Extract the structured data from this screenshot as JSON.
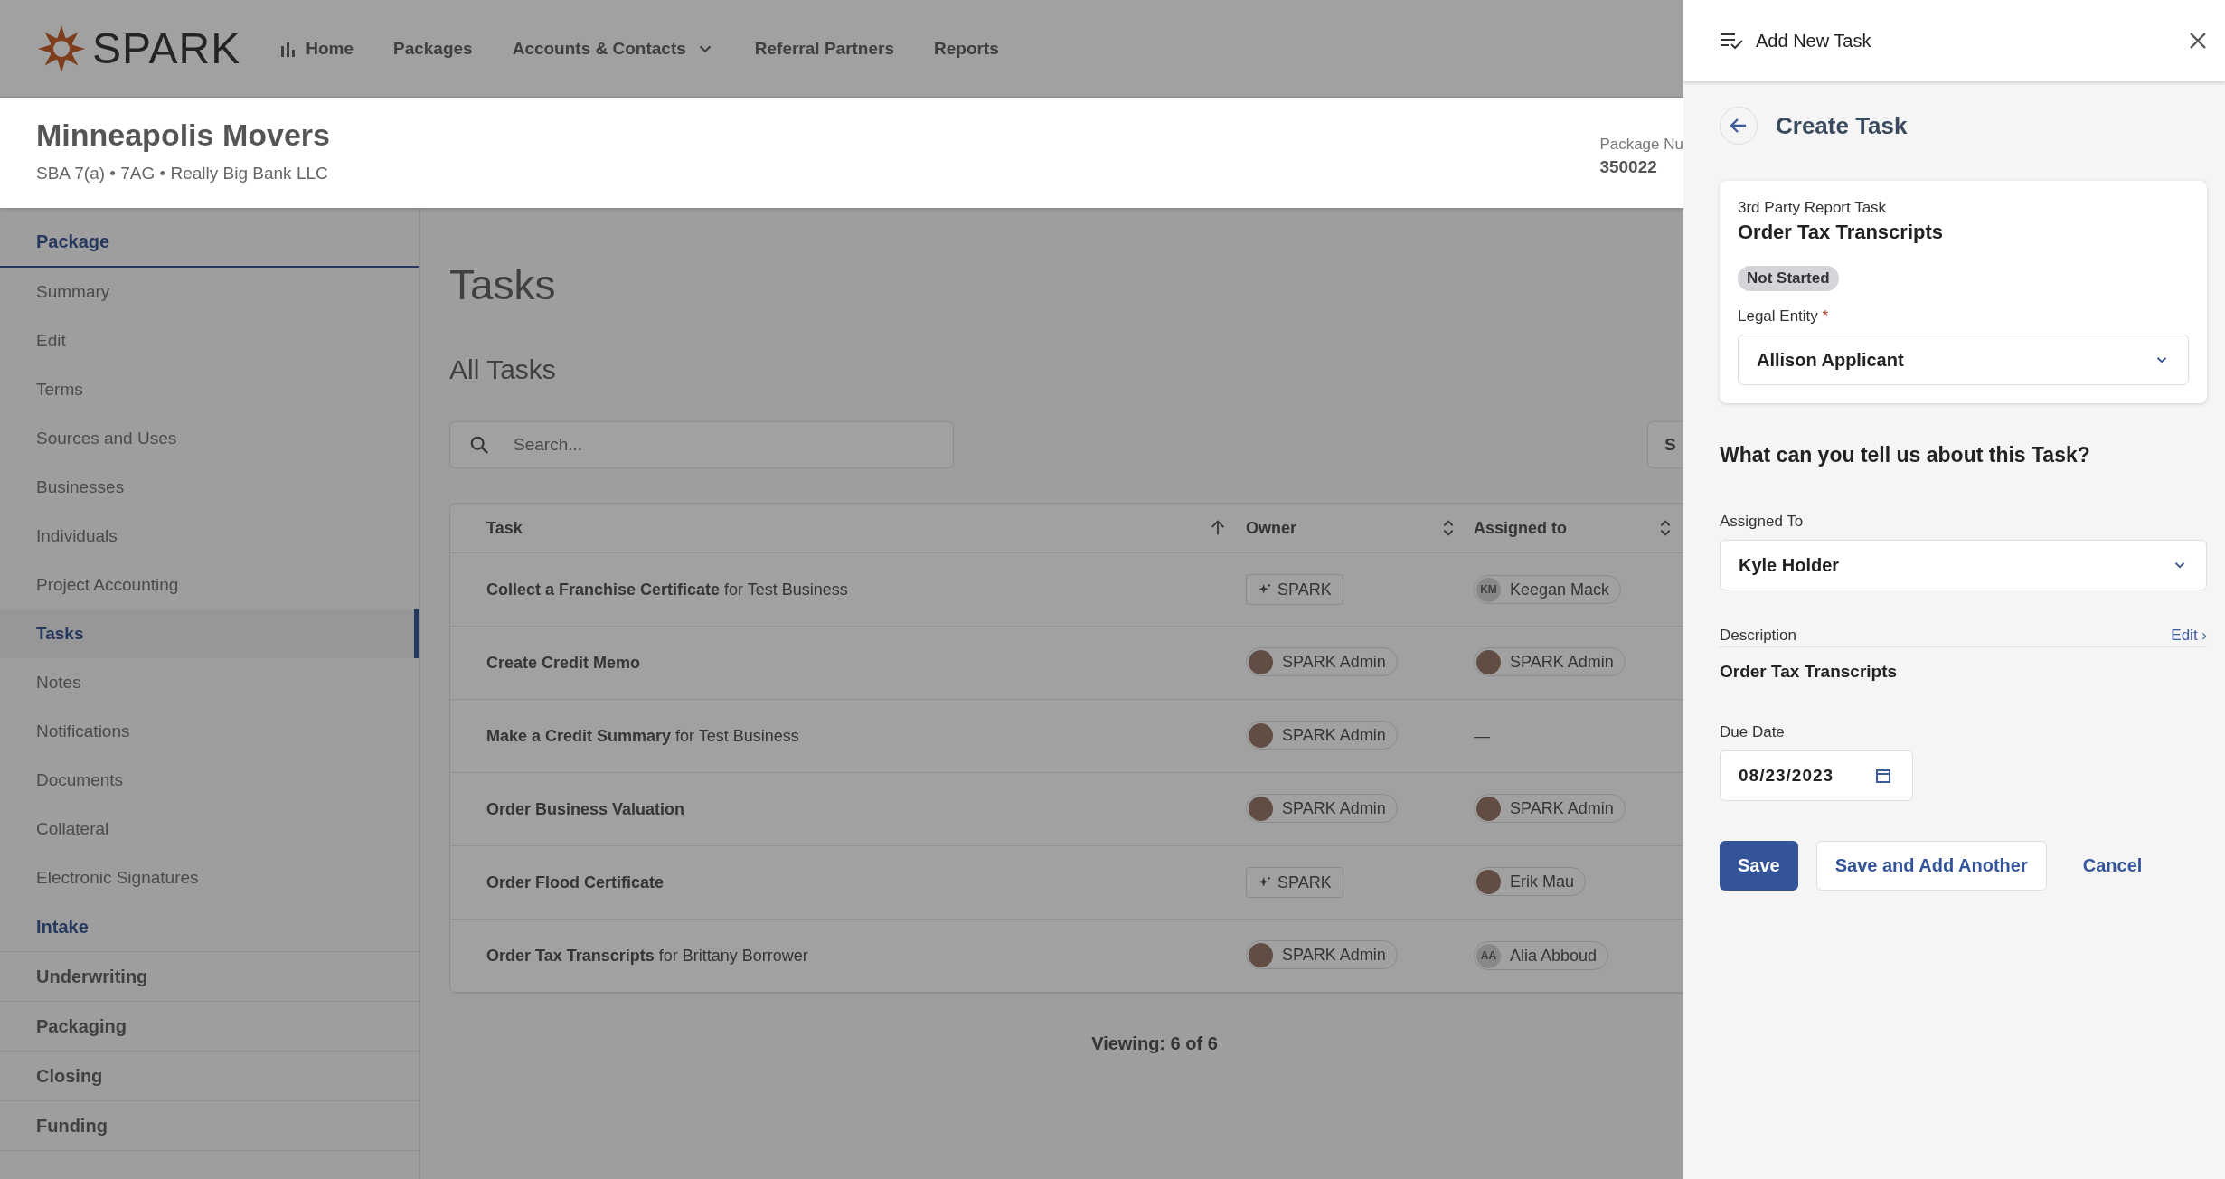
{
  "brand": {
    "name": "SPARK"
  },
  "nav": [
    {
      "label": "Home",
      "dropdown": false
    },
    {
      "label": "Packages",
      "dropdown": false
    },
    {
      "label": "Accounts & Contacts",
      "dropdown": true
    },
    {
      "label": "Referral Partners",
      "dropdown": false
    },
    {
      "label": "Reports",
      "dropdown": false
    }
  ],
  "package": {
    "title": "Minneapolis Movers",
    "subtitle": "SBA 7(a) • 7AG • Really Big Bank LLC",
    "number_label": "Package Nu",
    "number": "350022"
  },
  "sidebar": [
    {
      "label": "Package",
      "current": true,
      "expanded": true,
      "children": [
        {
          "label": "Summary",
          "selected": false
        },
        {
          "label": "Edit",
          "selected": false
        },
        {
          "label": "Terms",
          "selected": false
        },
        {
          "label": "Sources and Uses",
          "selected": false
        },
        {
          "label": "Businesses",
          "selected": false
        },
        {
          "label": "Individuals",
          "selected": false
        },
        {
          "label": "Project Accounting",
          "selected": false
        },
        {
          "label": "Tasks",
          "selected": true
        },
        {
          "label": "Notes",
          "selected": false
        },
        {
          "label": "Notifications",
          "selected": false
        },
        {
          "label": "Documents",
          "selected": false
        },
        {
          "label": "Collateral",
          "selected": false
        },
        {
          "label": "Electronic Signatures",
          "selected": false
        }
      ]
    },
    {
      "label": "Intake",
      "current": true,
      "expanded": false
    },
    {
      "label": "Underwriting",
      "current": false,
      "expanded": false
    },
    {
      "label": "Packaging",
      "current": false,
      "expanded": false
    },
    {
      "label": "Closing",
      "current": false,
      "expanded": false
    },
    {
      "label": "Funding",
      "current": false,
      "expanded": false
    }
  ],
  "page_title": "Tasks",
  "section_title": "All Tasks",
  "search": {
    "placeholder": "Search..."
  },
  "cut_button": {
    "label": "S"
  },
  "table": {
    "columns": [
      {
        "label": "Task",
        "sorted": true
      },
      {
        "label": "Owner",
        "sorted": false
      },
      {
        "label": "Assigned to",
        "sorted": false
      }
    ],
    "rows": [
      {
        "task": "Collect a Franchise Certificate",
        "suffix": "for Test Business",
        "owner": {
          "kind": "org",
          "name": "SPARK"
        },
        "assignee": {
          "kind": "initials",
          "initials": "KM",
          "name": "Keegan Mack"
        }
      },
      {
        "task": "Create Credit Memo",
        "owner": {
          "kind": "person",
          "name": "SPARK Admin"
        },
        "assignee": {
          "kind": "person",
          "name": "SPARK Admin"
        }
      },
      {
        "task": "Make a Credit Summary",
        "suffix": "for Test Business",
        "owner": {
          "kind": "person",
          "name": "SPARK Admin"
        },
        "assignee": {
          "kind": "none",
          "name": "—"
        }
      },
      {
        "task": "Order Business Valuation",
        "owner": {
          "kind": "person",
          "name": "SPARK Admin"
        },
        "assignee": {
          "kind": "person",
          "name": "SPARK Admin"
        }
      },
      {
        "task": "Order Flood Certificate",
        "owner": {
          "kind": "org",
          "name": "SPARK"
        },
        "assignee": {
          "kind": "person",
          "name": "Erik Mau"
        }
      },
      {
        "task": "Order Tax Transcripts",
        "suffix": "for Brittany Borrower",
        "owner": {
          "kind": "person",
          "name": "SPARK Admin"
        },
        "assignee": {
          "kind": "initials",
          "initials": "AA",
          "name": "Alia Abboud"
        }
      }
    ]
  },
  "viewing": "Viewing: 6 of 6",
  "panel": {
    "title": "Add New Task",
    "subtitle": "Create Task",
    "card": {
      "category": "3rd Party Report Task",
      "name": "Order Tax Transcripts",
      "status": "Not Started",
      "legal_entity_label": "Legal Entity",
      "required": "*",
      "legal_entity": "Allison Applicant"
    },
    "question": "What can you tell us about this Task?",
    "assigned_label": "Assigned To",
    "assigned": "Kyle Holder",
    "description_label": "Description",
    "edit_link": "Edit ›",
    "description": "Order Tax Transcripts",
    "due_label": "Due Date",
    "due": "08/23/2023",
    "buttons": [
      {
        "label": "Save",
        "kind": "primary"
      },
      {
        "label": "Save and Add Another",
        "kind": "secondary"
      },
      {
        "label": "Cancel",
        "kind": "text"
      }
    ]
  }
}
